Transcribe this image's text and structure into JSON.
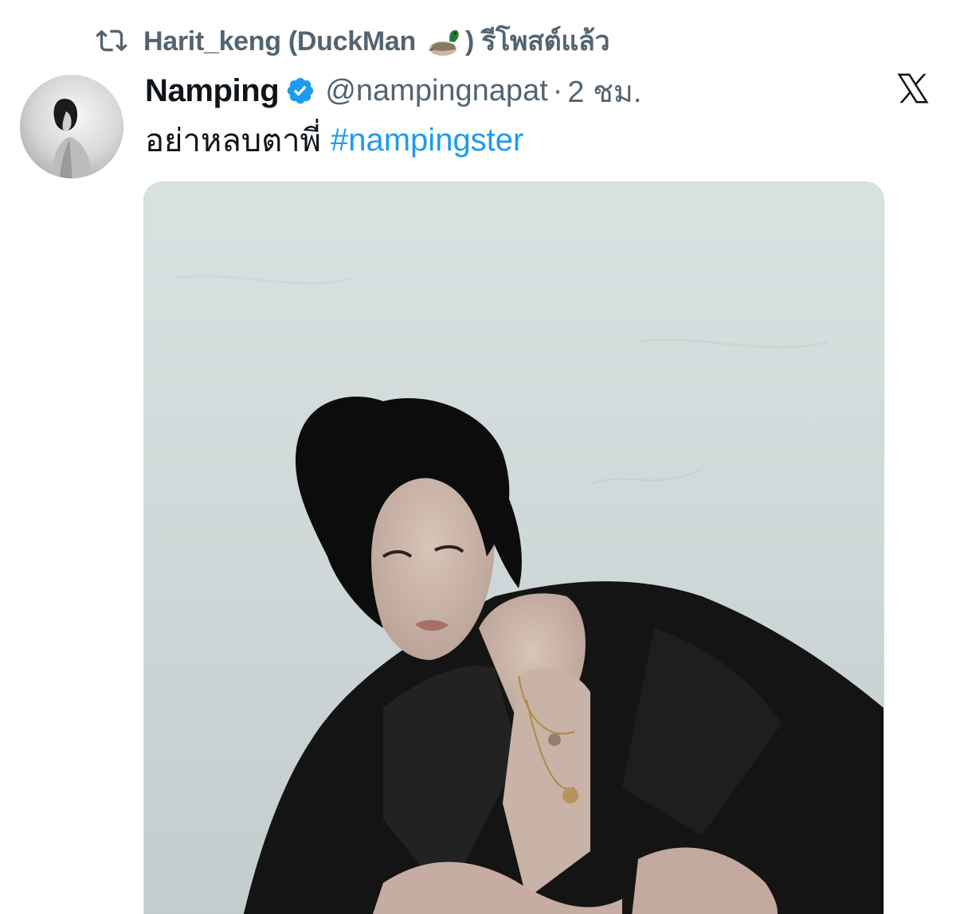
{
  "repost": {
    "user_name": "Harit_keng (DuckMan",
    "emoji_icon": "mallard-duck-emoji",
    "suffix": ") รีโพสต์แล้ว"
  },
  "tweet": {
    "display_name": "Namping",
    "verified": true,
    "handle": "@nampingnapat",
    "separator": "·",
    "timestamp": "2 ชม.",
    "text": "อย่าหลบตาพี่",
    "hashtag": "#nampingster",
    "avatar_icon": "profile-photo",
    "media_icon": "portrait-photo"
  },
  "brand": {
    "logo_icon": "x-logo"
  },
  "colors": {
    "primary_text": "#0f1419",
    "secondary_text": "#536471",
    "accent": "#1d9bf0",
    "background": "#ffffff"
  }
}
